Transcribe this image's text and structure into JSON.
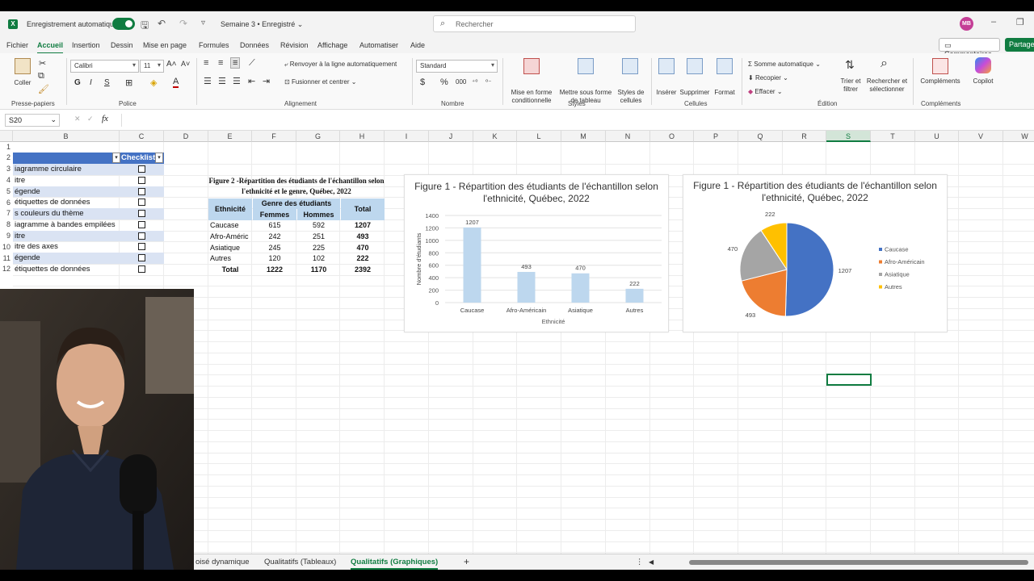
{
  "titlebar": {
    "autosave": "Enregistrement automatique",
    "doc": "Semaine 3 • Enregistré",
    "search": "Rechercher",
    "user": "MB"
  },
  "menu": [
    "Fichier",
    "Accueil",
    "Insertion",
    "Dessin",
    "Mise en page",
    "Formules",
    "Données",
    "Révision",
    "Affichage",
    "Automatiser",
    "Aide"
  ],
  "menu_active": "Accueil",
  "comments": "Commentaires",
  "share": "Partager",
  "ribbon": {
    "paste": "Coller",
    "font": "Calibri",
    "size": "11",
    "wrap": "Renvoyer à la ligne automatiquement",
    "merge": "Fusionner et centrer",
    "format": "Standard",
    "cond": "Mise en forme conditionnelle",
    "astable": "Mettre sous forme de tableau",
    "cellstyles": "Styles de cellules",
    "insert": "Insérer",
    "delete": "Supprimer",
    "fmt": "Format",
    "autosum": "Somme automatique",
    "fill": "Recopier",
    "clear": "Effacer",
    "sort": "Trier et filtrer",
    "find": "Rechercher et sélectionner",
    "addins": "Compléments",
    "copilot": "Copilot",
    "groups": [
      "Presse-papiers",
      "Police",
      "Alignement",
      "Nombre",
      "Styles",
      "Cellules",
      "Édition",
      "Compléments"
    ]
  },
  "namebox": "S20",
  "fx": "fx",
  "columns": [
    "B",
    "C",
    "D",
    "E",
    "F",
    "G",
    "H",
    "I",
    "J",
    "K",
    "L",
    "M",
    "N",
    "O",
    "P",
    "Q",
    "R",
    "S",
    "T",
    "U",
    "V",
    "W"
  ],
  "rows": [
    "1",
    "2",
    "3",
    "4",
    "5",
    "6",
    "7",
    "8",
    "9",
    "10",
    "11",
    "12"
  ],
  "checklist": {
    "header": "Checklist",
    "items": [
      "iagramme circulaire",
      "itre",
      "égende",
      "étiquettes de données",
      "s couleurs du thème",
      "iagramme à bandes empilées",
      "itre",
      "itre des axes",
      "égende",
      "étiquettes de données"
    ]
  },
  "table": {
    "title": "Figure 2 -Répartition des étudiants de l'échantillon selon l'ethnicité et le genre, Québec, 2022",
    "h_eth": "Ethnicité",
    "h_genre": "Genre des étudiants",
    "h_total": "Total",
    "h_f": "Femmes",
    "h_h": "Hommes",
    "rows": [
      [
        "Caucase",
        "615",
        "592",
        "1207"
      ],
      [
        "Afro-Améric",
        "242",
        "251",
        "493"
      ],
      [
        "Asiatique",
        "245",
        "225",
        "470"
      ],
      [
        "Autres",
        "120",
        "102",
        "222"
      ]
    ],
    "total": [
      "Total",
      "1222",
      "1170",
      "2392"
    ]
  },
  "chart_data": [
    {
      "type": "bar",
      "title": "Figure 1 - Répartition des étudiants de l'échantillon selon l'ethnicité, Québec, 2022",
      "categories": [
        "Caucase",
        "Afro-Américain",
        "Asiatique",
        "Autres"
      ],
      "values": [
        1207,
        493,
        470,
        222
      ],
      "xlabel": "Ethnicité",
      "ylabel": "Nombre d'étudiants",
      "ylim": [
        0,
        1400
      ],
      "yticks": [
        0,
        200,
        400,
        600,
        800,
        1000,
        1200,
        1400
      ],
      "color": "#bdd7ee",
      "grid": true
    },
    {
      "type": "pie",
      "title": "Figure 1 - Répartition des étudiants de l'échantillon selon l'ethnicité, Québec, 2022",
      "categories": [
        "Caucase",
        "Afro-Américain",
        "Asiatique",
        "Autres"
      ],
      "values": [
        1207,
        493,
        470,
        222
      ],
      "colors": [
        "#4472c4",
        "#ed7d31",
        "#a5a5a5",
        "#ffc000"
      ],
      "legend": "right"
    }
  ],
  "tabs": [
    "oisé dynamique",
    "Qualitatifs (Tableaux)",
    "Qualitatifs (Graphiques)"
  ],
  "tab_active": "Qualitatifs (Graphiques)"
}
